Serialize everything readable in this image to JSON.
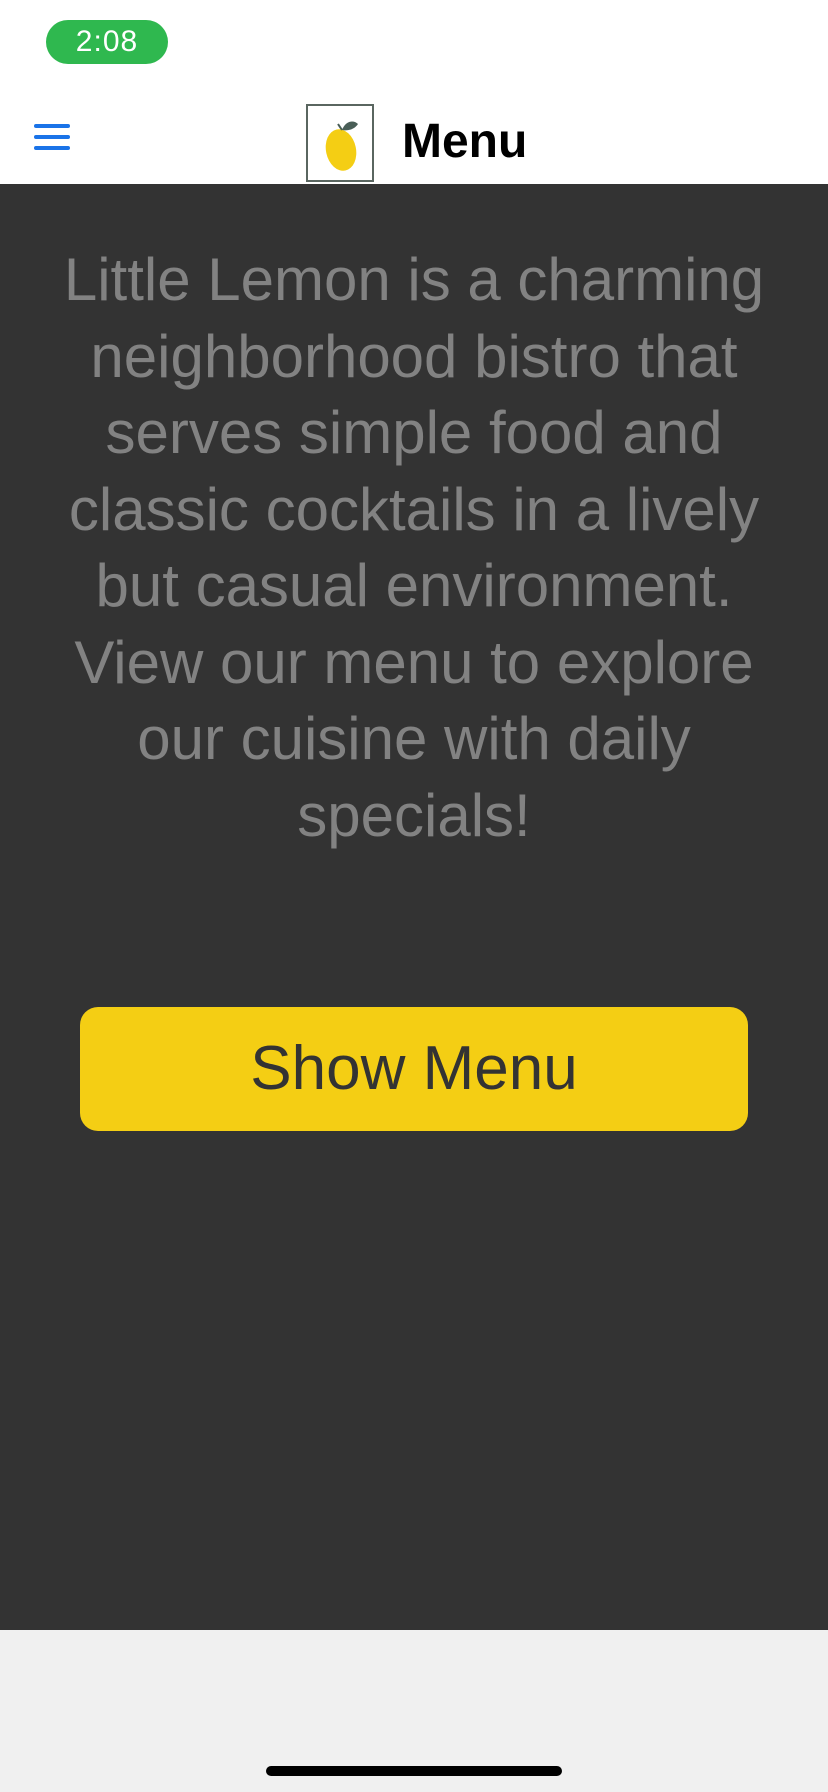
{
  "status_bar": {
    "time": "2:08",
    "time_pill_color": "#2fb84f"
  },
  "nav": {
    "menu_icon": "hamburger-menu-icon",
    "logo_icon": "lemon-icon",
    "title": "Menu"
  },
  "main": {
    "description": "Little Lemon is a charming neighborhood bistro that serves simple food and classic cocktails in a lively but casual environment. View our menu to explore our cuisine with daily specials!",
    "button_label": "Show Menu"
  },
  "colors": {
    "background": "#333333",
    "text": "#828282",
    "button": "#f4ce14",
    "button_text": "#333333",
    "menu_icon": "#1a73e8"
  }
}
